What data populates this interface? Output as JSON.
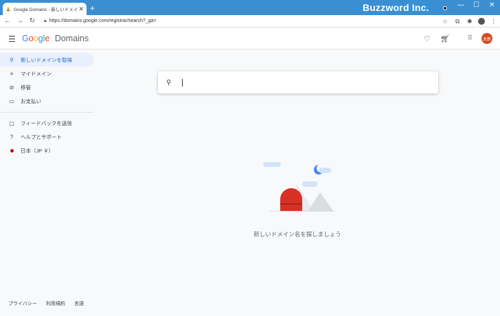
{
  "browser": {
    "tab_title": "Google Domains - 新しいドメイン名",
    "tab_close": "✕",
    "new_tab": "+",
    "url": "https://domains.google.com/registrar/search?_ga=",
    "brand": "Buzzword Inc.",
    "window_controls": {
      "minimize": "—",
      "maximize": "☐",
      "close": "✕"
    }
  },
  "header": {
    "logo_letters": [
      "G",
      "o",
      "o",
      "g",
      "l",
      "e"
    ],
    "logo_product": "Domains",
    "avatar_text": "太郎"
  },
  "sidebar": {
    "items": [
      {
        "label": "新しいドメインを取得",
        "icon": "search-icon"
      },
      {
        "label": "マイドメイン",
        "icon": "list-icon"
      },
      {
        "label": "移管",
        "icon": "transfer-icon"
      },
      {
        "label": "お支払い",
        "icon": "card-icon"
      },
      {
        "label": "フィードバックを送信",
        "icon": "feedback-icon"
      },
      {
        "label": "ヘルプとサポート",
        "icon": "help-icon"
      },
      {
        "label": "日本（JP ￥）",
        "icon": "flag-icon"
      }
    ],
    "footer": [
      "プライバシー",
      "利用規約",
      "言語"
    ]
  },
  "main": {
    "search_placeholder": "",
    "empty_message": "新しいドメイン名を探しましょう"
  },
  "colors": {
    "accent": "#1967d2",
    "titlebar": "#3a8fd3",
    "avatar": "#d14c21"
  }
}
